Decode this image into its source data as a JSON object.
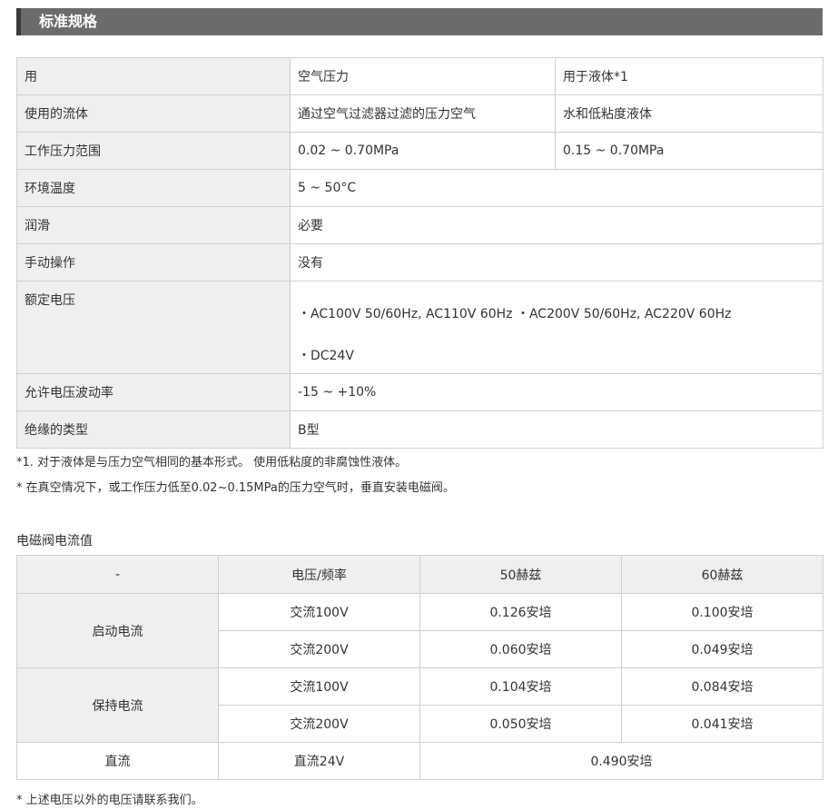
{
  "section_title": "标准规格",
  "spec_table": {
    "header": {
      "label": "用",
      "col1": "空气压力",
      "col2": "用于液体*1"
    },
    "fluid": {
      "label": "使用的流体",
      "col1": "通过空气过滤器过滤的压力空气",
      "col2": "水和低粘度液体"
    },
    "pressure": {
      "label": "工作压力范围",
      "col1": "0.02 ~ 0.70MPa",
      "col2": "0.15 ~ 0.70MPa"
    },
    "ambient_temp": {
      "label": "环境温度",
      "value": "5 ~ 50°C"
    },
    "lubrication": {
      "label": "润滑",
      "value": "必要"
    },
    "manual_operation": {
      "label": "手动操作",
      "value": "没有"
    },
    "rated_voltage": {
      "label": "额定电压",
      "line1": "・AC100V 50/60Hz, AC110V 60Hz ・AC200V 50/60Hz, AC220V 60Hz",
      "line2": "・DC24V"
    },
    "voltage_fluctuation": {
      "label": "允许电压波动率",
      "value": "-15 ~ +10%"
    },
    "insulation": {
      "label": "绝缘的类型",
      "value": "B型"
    }
  },
  "notes": {
    "note1": "*1. 对于液体是与压力空气相同的基本形式。 使用低粘度的非腐蚀性液体。",
    "note2": "* 在真空情况下，或工作压力低至0.02~0.15MPa的压力空气时，垂直安装电磁阀。"
  },
  "current_section_title": "电磁阀电流值",
  "current_table": {
    "headers": [
      "-",
      "电压/频率",
      "50赫兹",
      "60赫兹"
    ],
    "startup": {
      "label": "启动电流",
      "rows": [
        {
          "voltage": "交流100V",
          "hz50": "0.126安培",
          "hz60": "0.100安培"
        },
        {
          "voltage": "交流200V",
          "hz50": "0.060安培",
          "hz60": "0.049安培"
        }
      ]
    },
    "holding": {
      "label": "保持电流",
      "rows": [
        {
          "voltage": "交流100V",
          "hz50": "0.104安培",
          "hz60": "0.084安培"
        },
        {
          "voltage": "交流200V",
          "hz50": "0.050安培",
          "hz60": "0.041安培"
        }
      ]
    },
    "dc": {
      "label": "直流",
      "voltage": "直流24V",
      "value": "0.490安培"
    }
  },
  "footnote": "* 上述电压以外的电压请联系我们。"
}
